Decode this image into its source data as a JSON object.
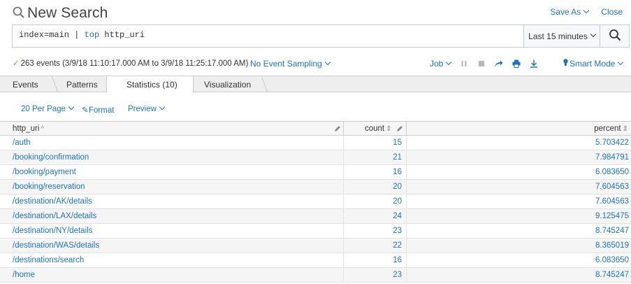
{
  "header": {
    "title": "New Search",
    "save_as": "Save As",
    "close": "Close"
  },
  "search": {
    "query_prefix": "index=main | ",
    "query_keyword": "top",
    "query_suffix": " http_uri",
    "time_range": "Last 15 minutes"
  },
  "status": {
    "events_text": "263 events (3/9/18 11:10:17.000 AM to 3/9/18 11:25:17.000 AM)",
    "sampling": "No Event Sampling",
    "job": "Job",
    "mode": "Smart Mode"
  },
  "tabs": [
    {
      "label": "Events",
      "active": false
    },
    {
      "label": "Patterns",
      "active": false
    },
    {
      "label": "Statistics (10)",
      "active": true
    },
    {
      "label": "Visualization",
      "active": false
    }
  ],
  "toolbar": {
    "per_page": "20 Per Page",
    "format": "Format",
    "preview": "Preview"
  },
  "table": {
    "columns": [
      "http_uri",
      "count",
      "percent"
    ],
    "rows": [
      {
        "uri": "/auth",
        "count": "15",
        "percent": "5.703422"
      },
      {
        "uri": "/booking/confirmation",
        "count": "21",
        "percent": "7.984791"
      },
      {
        "uri": "/booking/payment",
        "count": "16",
        "percent": "6.083650"
      },
      {
        "uri": "/booking/reservation",
        "count": "20",
        "percent": "7.604563"
      },
      {
        "uri": "/destination/AK/details",
        "count": "20",
        "percent": "7.604563"
      },
      {
        "uri": "/destination/LAX/details",
        "count": "24",
        "percent": "9.125475"
      },
      {
        "uri": "/destination/NY/details",
        "count": "23",
        "percent": "8.745247"
      },
      {
        "uri": "/destination/WAS/details",
        "count": "22",
        "percent": "8.365019"
      },
      {
        "uri": "/destinations/search",
        "count": "16",
        "percent": "6.083650"
      },
      {
        "uri": "/home",
        "count": "23",
        "percent": "8.745247"
      }
    ]
  },
  "colors": {
    "link": "#1e73be",
    "check": "#5cc05c"
  }
}
